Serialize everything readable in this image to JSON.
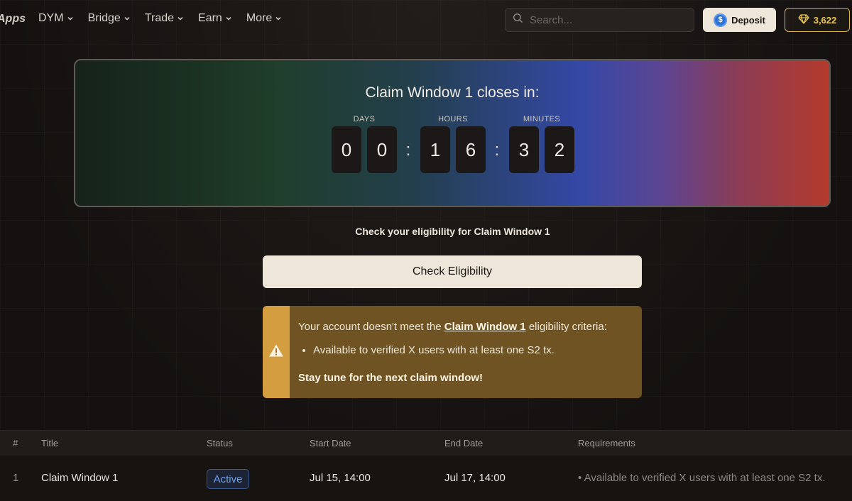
{
  "nav": {
    "brand": "Apps",
    "menu": [
      {
        "label": "DYM"
      },
      {
        "label": "Bridge"
      },
      {
        "label": "Trade"
      },
      {
        "label": "Earn"
      },
      {
        "label": "More"
      }
    ],
    "search_placeholder": "Search...",
    "deposit_label": "Deposit",
    "deposit_icon": "usdc-coin-icon",
    "points_value": "3,622",
    "points_icon": "diamond-icon",
    "colors": {
      "accent_gold": "#d8b24a",
      "deposit_bg": "#efe6da"
    }
  },
  "countdown": {
    "title": "Claim Window 1 closes in:",
    "labels": {
      "days": "DAYS",
      "hours": "HOURS",
      "minutes": "MINUTES"
    },
    "digits": {
      "days": [
        "0",
        "0"
      ],
      "hours": [
        "1",
        "6"
      ],
      "minutes": [
        "3",
        "2"
      ]
    },
    "separator": ":"
  },
  "eligibility": {
    "prompt": "Check your eligibility for Claim Window 1",
    "button_label": "Check Eligibility",
    "warning": {
      "icon": "warning-triangle-icon",
      "prefix": "Your account doesn't meet the ",
      "link": "Claim Window 1",
      "suffix": " eligibility criteria:",
      "bullets": [
        "Available to verified X users with at least one S2 tx."
      ],
      "footer": "Stay tune for the next claim window!"
    }
  },
  "table": {
    "headers": [
      "#",
      "Title",
      "Status",
      "Start Date",
      "End Date",
      "Requirements"
    ],
    "rows": [
      {
        "num": "1",
        "title": "Claim Window 1",
        "status": "Active",
        "start": "Jul 15, 14:00",
        "end": "Jul 17, 14:00",
        "requirement": "Available to verified X users with at least one S2 tx."
      }
    ]
  }
}
